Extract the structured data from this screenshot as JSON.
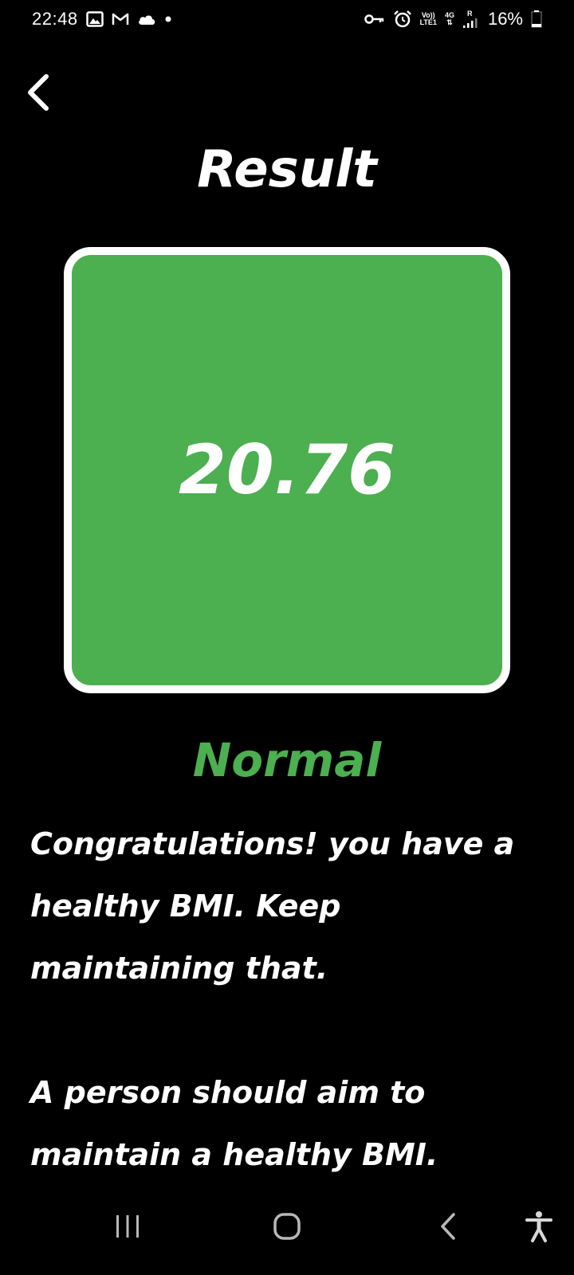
{
  "status_bar": {
    "time": "22:48",
    "left_icons": [
      "gallery-icon",
      "gmail-icon",
      "cloud-icon",
      "dot-icon"
    ],
    "right_icons": [
      "vpn-key-icon",
      "alarm-icon",
      "volte-icon",
      "network-4g-icon",
      "signal-icon",
      "battery-icon"
    ],
    "volte_top": "Vo))",
    "volte_bottom": "LTE1",
    "network_type": "4G",
    "roaming": "R",
    "battery_percent": "16%"
  },
  "header": {
    "back_icon": "chevron-left-icon",
    "title": "Result"
  },
  "result": {
    "bmi_value": "20.76",
    "category": "Normal",
    "card_color": "#4caf50",
    "category_color": "#4caf50",
    "message": "Congratulations! you have a healthy BMI. Keep maintaining that.",
    "advice": "A person should aim to maintain a healthy BMI. Working with a"
  },
  "nav_bar": {
    "recents_icon": "recents-icon",
    "home_icon": "home-icon",
    "back_icon": "nav-back-icon",
    "accessibility_icon": "accessibility-icon"
  }
}
